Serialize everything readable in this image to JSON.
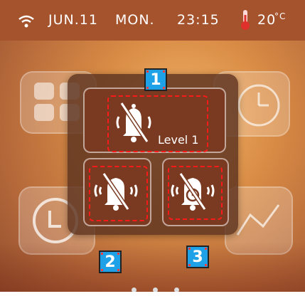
{
  "status": {
    "date": "JUN.11",
    "day": "MON.",
    "time": "23:15",
    "temperature": "20",
    "temperature_unit": "°C"
  },
  "modes": [
    {
      "id": "mute-level1",
      "label": "Level 1",
      "icon": "bell-off-icon",
      "badge": "1"
    },
    {
      "id": "mute-vibrate",
      "label": "",
      "icon": "bell-off-vibrate-icon",
      "badge": "2"
    },
    {
      "id": "mute-timer",
      "label": "",
      "icon": "bell-off-timer-icon",
      "badge": "3"
    }
  ],
  "colors": {
    "statusbar": "#a5532d",
    "panel": "#5c3220",
    "tile": "#7a3a21",
    "highlight": "#ff1a1a",
    "badge": "#1ea1e6"
  },
  "pagination": {
    "count": 3
  }
}
